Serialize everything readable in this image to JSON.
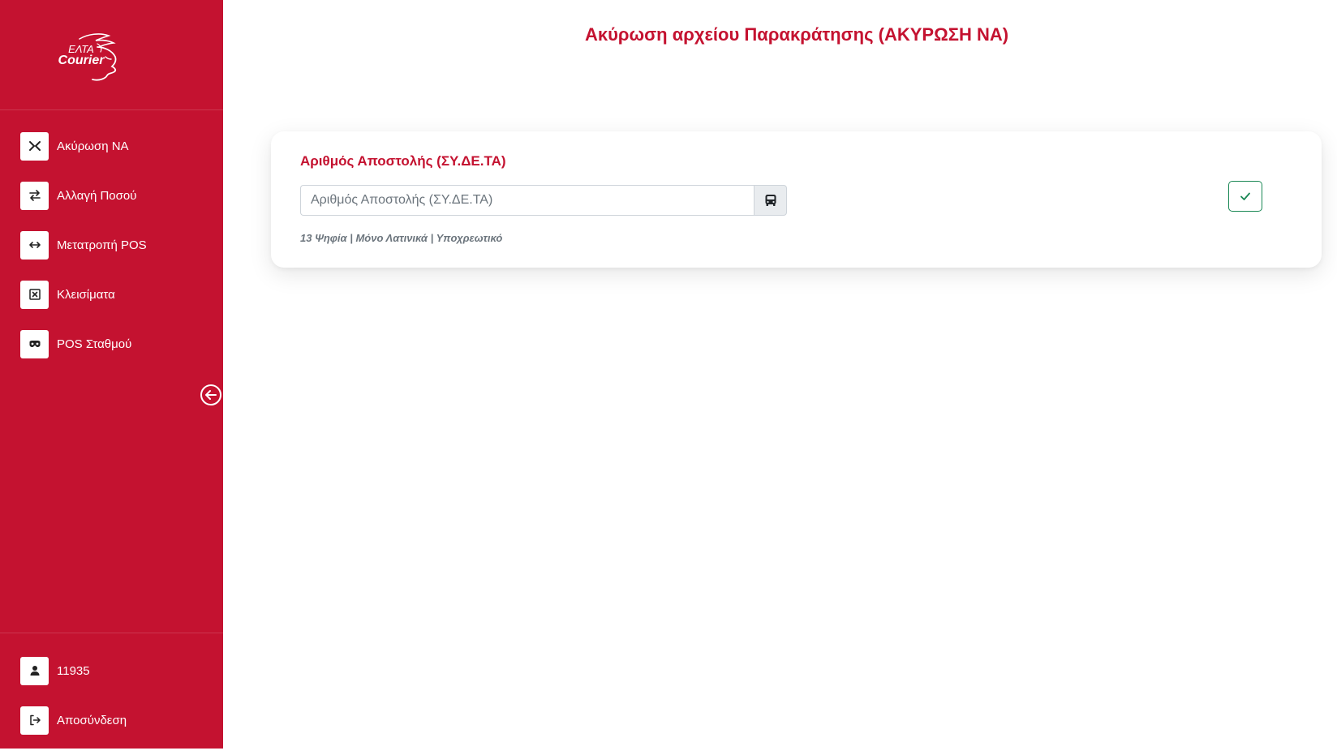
{
  "brand": {
    "logo_line1": "ΕΛΤΑ",
    "logo_line2": "Courier",
    "logo_icon": "hermes-winged-head-logo",
    "primary_color": "#c41230",
    "success_color": "#198754"
  },
  "sidebar": {
    "items": [
      {
        "label": "Ακύρωση ΝΑ",
        "icon": "compress-arrows-icon"
      },
      {
        "label": "Αλλαγή Ποσού",
        "icon": "exchange-arrows-icon"
      },
      {
        "label": "Μετατροπή POS",
        "icon": "horizontal-arrows-icon"
      },
      {
        "label": "Κλεισίματα",
        "icon": "square-x-icon"
      },
      {
        "label": "POS Σταθμού",
        "icon": "mask-icon"
      }
    ],
    "collapse_icon": "arrow-left-circle-icon",
    "user": {
      "label": "11935",
      "icon": "user-icon"
    },
    "logout": {
      "label": "Αποσύνδεση",
      "icon": "sign-out-icon"
    }
  },
  "main": {
    "title": "Ακύρωση αρχείου Παρακράτησης (ΑΚΥΡΩΣΗ ΝΑ)",
    "form": {
      "label": "Αριθμός Αποστολής (ΣΥ.ΔΕ.ΤΑ)",
      "value": "",
      "placeholder": "Αριθμός Αποστολής (ΣΥ.ΔΕ.ΤΑ)",
      "addon_icon": "bus-icon",
      "hint": "13 Ψηφία | Μόνο Λατινικά | Υποχρεωτικό",
      "submit_icon": "check-icon"
    }
  }
}
